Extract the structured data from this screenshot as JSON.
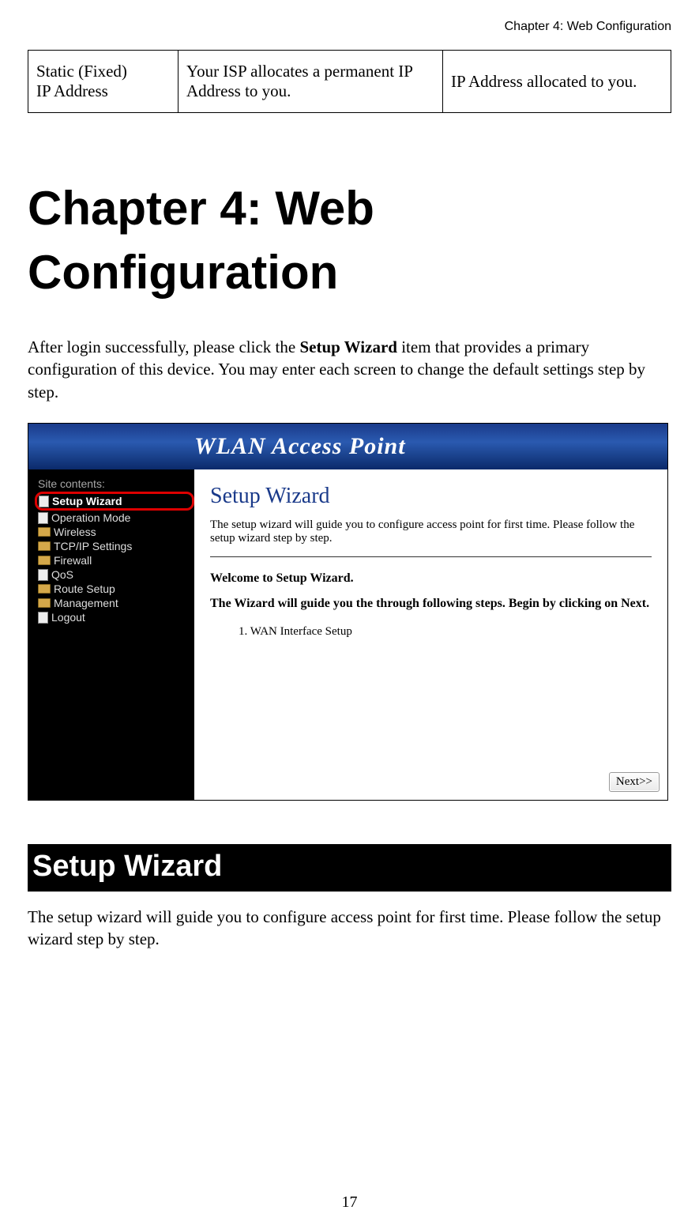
{
  "header": {
    "running_head": "Chapter 4: Web Configuration"
  },
  "table": {
    "col1_line1": "Static (Fixed)",
    "col1_line2": "IP Address",
    "col2": "Your ISP allocates a permanent IP Address to you.",
    "col3": "IP Address allocated to you."
  },
  "chapter_title": "Chapter 4: Web Configuration",
  "intro": {
    "pre": "After login successfully, please click the ",
    "bold": "Setup Wizard",
    "post": " item that provides a primary configuration of this device. You may enter each screen to change the default settings step by step."
  },
  "screenshot": {
    "banner": "WLAN Access Point",
    "sidebar_title": "Site contents:",
    "sidebar_items": [
      "Setup Wizard",
      "Operation Mode",
      "Wireless",
      "TCP/IP Settings",
      "Firewall",
      "QoS",
      "Route Setup",
      "Management",
      "Logout"
    ],
    "content": {
      "title": "Setup Wizard",
      "desc": "The setup wizard will guide you to configure access point for first time. Please follow the setup wizard step by step.",
      "welcome": "Welcome to Setup Wizard.",
      "guide": "The Wizard will guide you the through following steps. Begin by clicking on Next.",
      "step1": "1.    WAN Interface Setup",
      "next_button": "Next>>"
    }
  },
  "section": {
    "banner": "Setup Wizard",
    "para": "The setup wizard will guide you to configure access point for first time. Please follow the setup wizard step by step."
  },
  "page_number": "17"
}
